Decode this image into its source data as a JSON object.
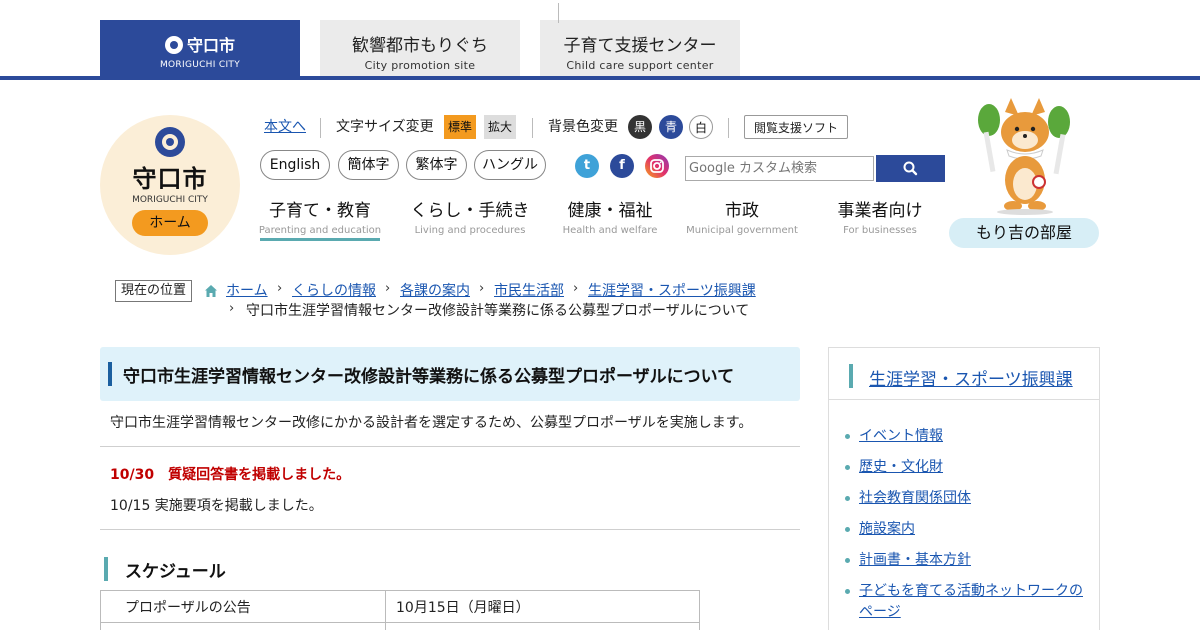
{
  "site_tabs": [
    {
      "title": "守口市",
      "subtitle": "MORIGUCHI CITY",
      "active": true
    },
    {
      "title": "歓響都市もりぐち",
      "subtitle": "City promotion site",
      "active": false
    },
    {
      "title": "子育て支援センター",
      "subtitle": "Child care support center",
      "active": false
    }
  ],
  "logo": {
    "name": "守口市",
    "roman": "MORIGUCHI CITY",
    "home_label": "ホーム"
  },
  "utility": {
    "skip_link": "本文へ",
    "font_size_label": "文字サイズ変更",
    "font_standard": "標準",
    "font_large": "拡大",
    "bg_color_label": "背景色変更",
    "bg_black": "黒",
    "bg_blue": "青",
    "bg_white": "白",
    "assist_software": "閲覧支援ソフト"
  },
  "languages": [
    "English",
    "簡体字",
    "繁体字",
    "ハングル"
  ],
  "sns": {
    "twitter": "t",
    "facebook": "f"
  },
  "search": {
    "placeholder": "Google カスタム検索"
  },
  "nav": [
    {
      "jp": "子育て・教育",
      "en": "Parenting and education",
      "active": true
    },
    {
      "jp": "くらし・手続き",
      "en": "Living and procedures",
      "active": false
    },
    {
      "jp": "健康・福祉",
      "en": "Health and welfare",
      "active": false
    },
    {
      "jp": "市政",
      "en": "Municipal government",
      "active": false
    },
    {
      "jp": "事業者向け",
      "en": "For businesses",
      "active": false
    }
  ],
  "mascot_link": "もり吉の部屋",
  "breadcrumb": {
    "label": "現在の位置",
    "items": [
      "ホーム",
      "くらしの情報",
      "各課の案内",
      "市民生活部",
      "生涯学習・スポーツ振興課"
    ],
    "current": "守口市生涯学習情報センター改修設計等業務に係る公募型プロポーザルについて"
  },
  "article": {
    "title": "守口市生涯学習情報センター改修設計等業務に係る公募型プロポーザルについて",
    "intro": "守口市生涯学習情報センター改修にかかる設計者を選定するため、公募型プロポーザルを実施します。",
    "notice_red": "10/30　質疑回答書を掲載しました。",
    "notice": "10/15 実施要項を掲載しました。",
    "schedule_heading": "スケジュール",
    "schedule": [
      {
        "item": "プロポーザルの公告",
        "date": "10月15日（月曜日）"
      },
      {
        "item": "",
        "date": ""
      }
    ]
  },
  "sidebar": {
    "heading": "生涯学習・スポーツ振興課",
    "links": [
      "イベント情報",
      "歴史・文化財",
      "社会教育関係団体",
      "施設案内",
      "計画書・基本方針",
      "子どもを育てる活動ネットワークのページ"
    ]
  },
  "colors": {
    "brand_blue": "#2c4a9a",
    "accent_teal": "#5aaab0",
    "home_orange": "#f39a1f",
    "notice_red": "#c00000",
    "link_blue": "#1a56b0"
  }
}
